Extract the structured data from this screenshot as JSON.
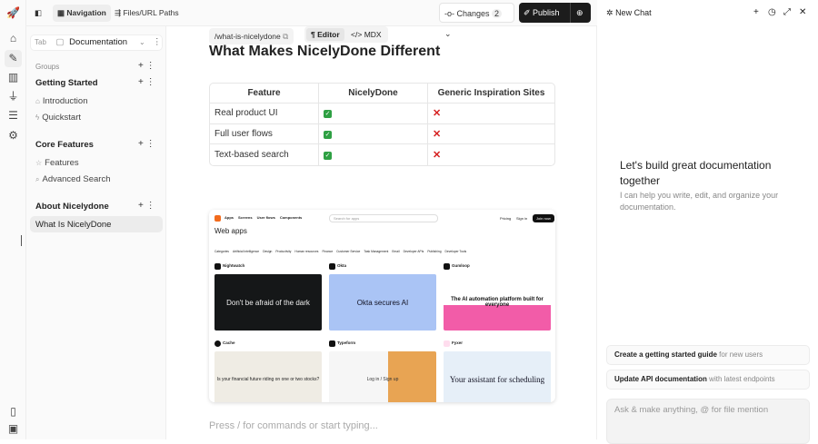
{
  "rail": {
    "icons": [
      "rocket-icon",
      "home-icon",
      "edit-icon",
      "chart-icon",
      "plug-icon",
      "database-icon",
      "gear-icon",
      "book-icon",
      "calendar-icon"
    ]
  },
  "topbar": {
    "nav_label": "Navigation",
    "files_label": "Files/URL Paths",
    "changes_label": "Changes",
    "changes_count": "2",
    "publish_label": "Publish"
  },
  "sidebar": {
    "tab_label": "Tab",
    "tab_value": "Documentation",
    "groups_label": "Groups",
    "groups": [
      {
        "title": "Getting Started",
        "items": [
          "Introduction",
          "Quickstart"
        ]
      },
      {
        "title": "Core Features",
        "items": [
          "Features",
          "Advanced Search"
        ]
      },
      {
        "title": "About Nicelydone",
        "items": [
          "What Is NicelyDone"
        ]
      }
    ]
  },
  "editor": {
    "path": "/what-is-nicelydone",
    "editor_tab": "Editor",
    "mdx_tab": "MDX",
    "heading": "What Makes NicelyDone Different",
    "table": {
      "headers": [
        "Feature",
        "NicelyDone",
        "Generic Inspiration Sites"
      ],
      "rows": [
        [
          "Real product UI",
          "✓",
          "✕"
        ],
        [
          "Full user flows",
          "✓",
          "✕"
        ],
        [
          "Text-based search",
          "✓",
          "✕"
        ]
      ]
    },
    "placeholder": "Press / for commands or start typing...",
    "shot": {
      "nav": [
        "Apps",
        "Screens",
        "User flows",
        "Components"
      ],
      "search": "Search for apps",
      "pricing": "Pricing",
      "signin": "Sign in",
      "join": "Join now",
      "title": "Web apps",
      "categories": [
        "Categories",
        "Artificial Intelligence",
        "Design",
        "Productivity",
        "Human resources",
        "Finance",
        "Customer Service",
        "Task Management",
        "Email",
        "Developer APIs",
        "Publishing",
        "Developer Tools"
      ],
      "cards": [
        {
          "name": "Nightwatch",
          "hero": "Don't be afraid of the dark"
        },
        {
          "name": "Okta",
          "hero": "Okta secures AI"
        },
        {
          "name": "Gumloop",
          "hero": "The AI automation platform built for everyone"
        },
        {
          "name": "Cache",
          "hero": "Is your financial future riding on one or two stocks?"
        },
        {
          "name": "Typeform",
          "hero": "Log in / Sign up"
        },
        {
          "name": "Fyxer",
          "hero": "Your assistant for scheduling"
        }
      ]
    }
  },
  "chat": {
    "title": "New Chat",
    "heading": "Let's build great documentation together",
    "sub": "I can help you write, edit, and organize your documentation.",
    "suggestions": [
      {
        "bold": "Create a getting started guide",
        "rest": " for new users"
      },
      {
        "bold": "Update API documentation",
        "rest": " with latest endpoints"
      }
    ],
    "input_placeholder": "Ask & make anything, @ for file mention"
  }
}
